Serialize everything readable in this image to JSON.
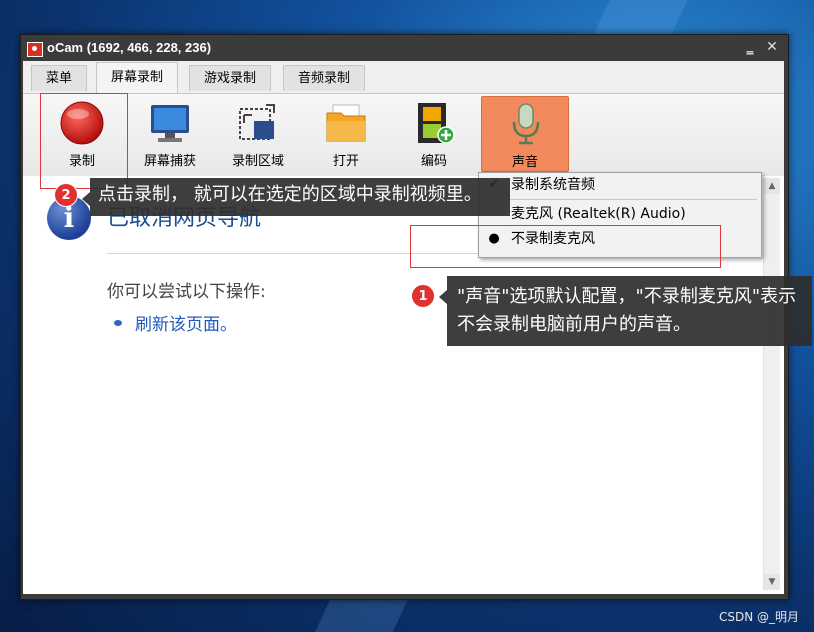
{
  "window": {
    "title": "oCam (1692, 466, 228, 236)",
    "min_symbol": "‗",
    "close_symbol": "✕"
  },
  "tabs": [
    {
      "label": "菜单"
    },
    {
      "label": "屏幕录制",
      "active": true
    },
    {
      "label": "游戏录制"
    },
    {
      "label": "音频录制"
    }
  ],
  "toolbar": {
    "record": "录制",
    "capture": "屏幕捕获",
    "area": "录制区域",
    "open": "打开",
    "encode": "编码",
    "sound": "声音"
  },
  "sound_menu": {
    "items": [
      {
        "label": "录制系统音频",
        "mark": "✔"
      },
      {
        "label": "麦克风 (Realtek(R) Audio)",
        "mark": ""
      },
      {
        "label": "不录制麦克风",
        "mark": "●"
      }
    ]
  },
  "browser_page": {
    "icon_letter": "i",
    "heading": "已取消网页导航",
    "suggest": "你可以尝试以下操作:",
    "refresh_link": "刷新该页面。"
  },
  "callouts": {
    "one": {
      "number": "1",
      "text": "\"声音\"选项默认配置，\"不录制麦克风\"表示不会录制电脑前用户的声音。"
    },
    "two": {
      "number": "2",
      "text": "点击录制， 就可以在选定的区域中录制视频里。"
    }
  },
  "watermark": "CSDN @_明月",
  "scrollbar": {
    "up": "▲",
    "down": "▼"
  },
  "colors": {
    "accent": "#f28a5e",
    "callout_red": "#e03030",
    "link": "#2158b8"
  }
}
